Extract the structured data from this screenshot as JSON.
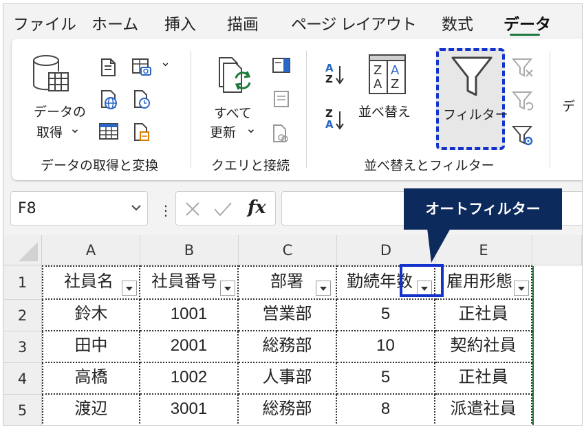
{
  "tabs": [
    "ファイル",
    "ホーム",
    "挿入",
    "描画",
    "ページ レイアウト",
    "数式",
    "データ"
  ],
  "active_tab": "データ",
  "ribbon": {
    "get_data": {
      "line1": "データの",
      "line2": "取得",
      "chev": "⌄"
    },
    "refresh_all": {
      "line1": "すべて",
      "line2": "更新",
      "chev": "⌄"
    },
    "sort": "並べ替え",
    "filter": "フィルター",
    "sort_az_top": "A",
    "sort_az_bottom": "Z",
    "sort_za_top": "Z",
    "sort_za_bottom": "A",
    "partial_label": "デ",
    "groups": [
      "データの取得と変換",
      "クエリと接続",
      "並べ替えとフィルター"
    ]
  },
  "formula_bar": {
    "name_box": "F8",
    "fx": "fx",
    "dots": "⋮",
    "value": ""
  },
  "callout": "オートフィルター",
  "sheet": {
    "columns": [
      "A",
      "B",
      "C",
      "D",
      "E"
    ],
    "rows": [
      "1",
      "2",
      "3",
      "4",
      "5"
    ],
    "header": [
      "社員名",
      "社員番号",
      "部署",
      "勤続年数",
      "雇用形態"
    ],
    "data": [
      [
        "鈴木",
        "1001",
        "営業部",
        "5",
        "正社員"
      ],
      [
        "田中",
        "2001",
        "総務部",
        "10",
        "契約社員"
      ],
      [
        "高橋",
        "1002",
        "人事部",
        "5",
        "正社員"
      ],
      [
        "渡辺",
        "3001",
        "総務部",
        "8",
        "派遣社員"
      ]
    ]
  },
  "colors": {
    "accent": "#1e7a3c",
    "highlight": "#1333cc",
    "callout_bg": "#0d2a5c"
  }
}
